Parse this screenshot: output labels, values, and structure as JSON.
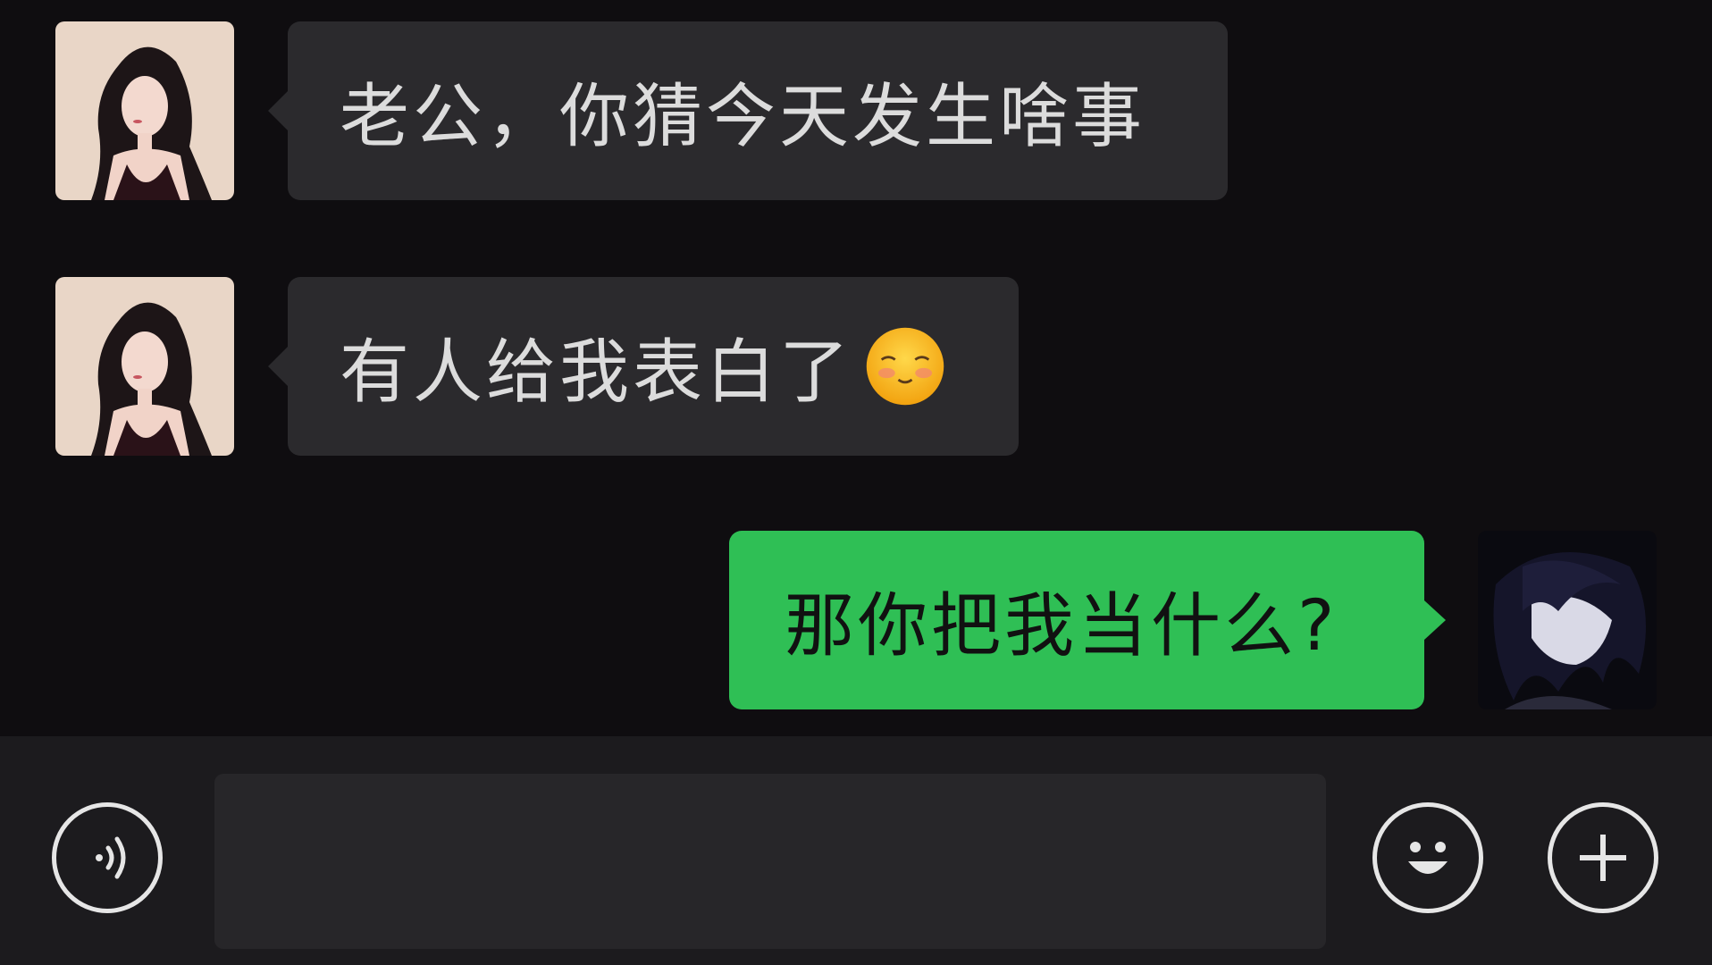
{
  "messages": [
    {
      "side": "left",
      "text": "老公，你猜今天发生啥事",
      "avatar": "girl-avatar-icon"
    },
    {
      "side": "left",
      "text": "有人给我表白了",
      "emoji": "shy-face-emoji-icon",
      "avatar": "girl-avatar-icon"
    },
    {
      "side": "right",
      "text": "那你把我当什么?",
      "avatar": "boy-avatar-icon"
    }
  ],
  "input_bar": {
    "voice_icon": "voice-icon",
    "input_value": "",
    "emoji_icon": "emoji-icon",
    "plus_icon": "plus-icon"
  },
  "colors": {
    "background": "#0f0d10",
    "left_bubble": "#2b2a2d",
    "right_bubble": "#2fbf55",
    "input_bar": "#1c1b1e"
  }
}
